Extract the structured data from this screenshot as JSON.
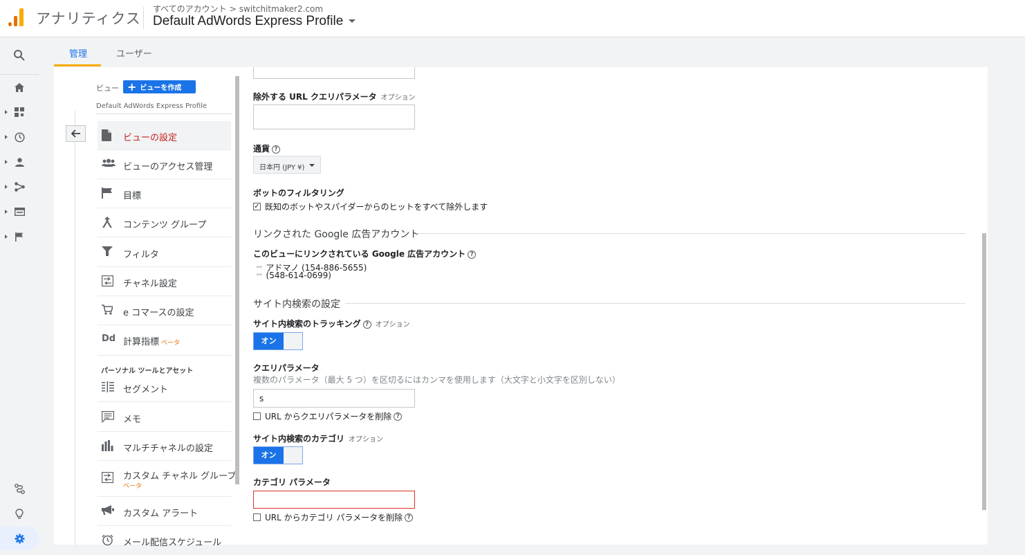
{
  "header": {
    "app_name": "アナリティクス",
    "breadcrumb_root": "すべてのアカウント",
    "breadcrumb_sep": ">",
    "breadcrumb_account": "switchitmaker2.com",
    "profile_name": "Default AdWords Express Profile"
  },
  "tabs": [
    {
      "label": "管理"
    },
    {
      "label": "ユーザー"
    }
  ],
  "view_panel": {
    "view_label": "ビュー",
    "create_button": "ビューを作成",
    "profile_name": "Default AdWords Express Profile",
    "items": [
      {
        "label": "ビューの設定",
        "icon": "document-icon"
      },
      {
        "label": "ビューのアクセス管理",
        "icon": "people-icon"
      },
      {
        "label": "目標",
        "icon": "flag-icon"
      },
      {
        "label": "コンテンツ グループ",
        "icon": "content-group-icon"
      },
      {
        "label": "フィルタ",
        "icon": "filter-icon"
      },
      {
        "label": "チャネル設定",
        "icon": "channel-icon"
      },
      {
        "label": "e コマースの設定",
        "icon": "cart-icon"
      },
      {
        "label": "計算指標",
        "beta": "ベータ",
        "icon": "calculated-metric-icon"
      }
    ],
    "personal_section": "パーソナル ツールとアセット",
    "personal_items": [
      {
        "label": "セグメント",
        "icon": "segment-icon"
      },
      {
        "label": "メモ",
        "icon": "memo-icon"
      },
      {
        "label": "マルチチャネルの設定",
        "icon": "bar-chart-icon"
      },
      {
        "label": "カスタム チャネル グループ",
        "beta": "ベータ",
        "icon": "channel-icon"
      },
      {
        "label": "カスタム アラート",
        "icon": "megaphone-icon"
      },
      {
        "label": "メール配信スケジュール",
        "icon": "alarm-icon"
      }
    ]
  },
  "settings": {
    "exclude_params_label": "除外する URL クエリパラメータ",
    "optional": "オプション",
    "currency_label": "通貨",
    "currency_value": "日本円 (JPY ¥)",
    "bot_filter_label": "ボットのフィルタリング",
    "bot_filter_checkbox": "既知のボットやスパイダーからのヒットをすべて除外します",
    "linked_ads_section": "リンクされた Google 広告アカウント",
    "linked_ads_label": "このビューにリンクされている Google 広告アカウント",
    "linked_accounts": [
      "アドマノ (154-886-5655)",
      "(548-614-0699)"
    ],
    "site_search_section": "サイト内検索の設定",
    "site_search_tracking_label": "サイト内検索のトラッキング",
    "toggle_on": "オン",
    "query_param_label": "クエリパラメータ",
    "query_param_hint": "複数のパラメータ（最大 5 つ）を区切るにはカンマを使用します（大文字と小文字を区別しない）",
    "query_param_value": "s",
    "strip_query_label": "URL からクエリパラメータを削除",
    "site_search_category_label": "サイト内検索のカテゴリ",
    "category_param_label": "カテゴリ パラメータ",
    "strip_category_label": "URL からカテゴリ パラメータを削除",
    "help_mark": "?"
  },
  "colors": {
    "accent": "#1a73e8",
    "active_text": "#c5221f",
    "tab_underline": "#f9ab00",
    "error_border": "#d93025"
  }
}
